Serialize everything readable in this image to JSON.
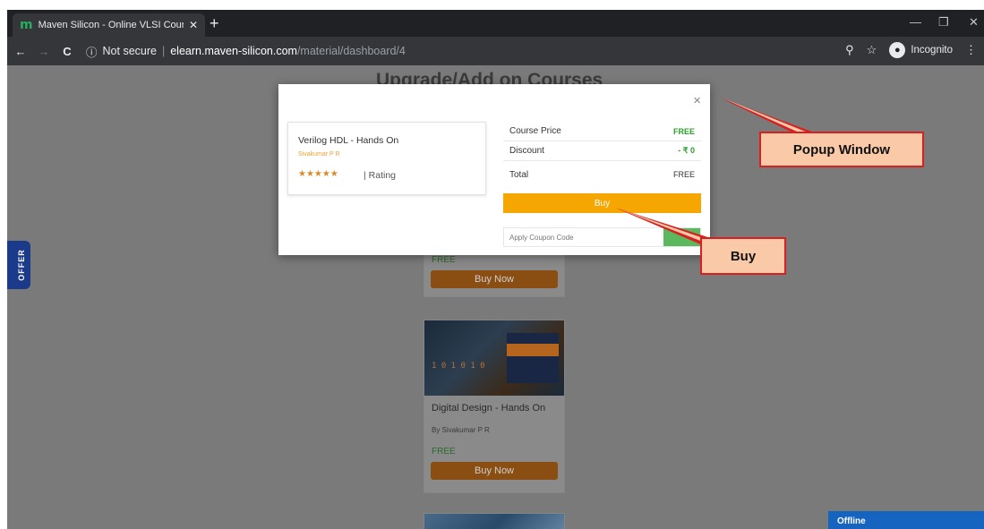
{
  "browser": {
    "tab_title": "Maven Silicon - Online VLSI Cour",
    "tab_logo": "m",
    "tab_close": "✕",
    "new_tab": "+",
    "security": "Not secure",
    "url_host": "elearn.maven-silicon.com",
    "url_path": "/material/dashboard/4",
    "incognito_label": "Incognito",
    "back_icon": "←",
    "forward_icon": "→",
    "reload_icon": "C",
    "info_icon": "ⓘ",
    "zoom_icon": "⚲",
    "star_icon": "☆",
    "menu_icon": "⋮",
    "minimize_icon": "—",
    "restore_icon": "❐",
    "close_icon": "✕"
  },
  "page": {
    "heading": "Upgrade/Add on Courses",
    "offer_tab": "OFFER",
    "offline": "Offline"
  },
  "cards": {
    "first": {
      "price": "FREE",
      "button": "Buy Now"
    },
    "second": {
      "title": "Digital Design - Hands On",
      "author": "By Sivakumar P R",
      "price": "FREE",
      "button": "Buy Now",
      "digits": "1 0  1 0 1 0"
    }
  },
  "popup": {
    "close": "×",
    "course_name": "Verilog HDL - Hands On",
    "author": "Sivakumar P R",
    "stars": "★★★★★",
    "rating": "| Rating",
    "course_price_label": "Course Price",
    "course_price_value": "FREE",
    "discount_label": "Discount",
    "discount_value": "- ₹ 0",
    "total_label": "Total",
    "total_value": "FREE",
    "buy_label": "Buy",
    "coupon_placeholder": "Apply Coupon Code"
  },
  "callouts": {
    "popup_window": "Popup Window",
    "buy": "Buy"
  },
  "colors": {
    "callout_fill": "#f9c9a8",
    "callout_border": "#d92020",
    "buy_button": "#f6a600",
    "apply_button": "#5cb85c"
  }
}
